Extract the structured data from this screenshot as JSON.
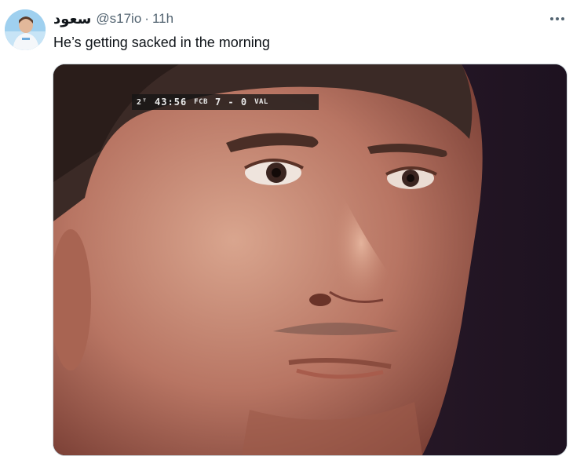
{
  "tweet": {
    "display_name": "سعود",
    "handle": "@s17io",
    "separator": "·",
    "time": "11h",
    "text": "He’s getting sacked in the morning",
    "more_icon": "more-horizontal-icon"
  },
  "media": {
    "scorebug": {
      "half": "2ᵀ",
      "clock": "43:56",
      "home_team": "FCB",
      "score": "7 - 0",
      "away_team": "VAL"
    }
  },
  "colors": {
    "text_primary": "#0f1419",
    "text_secondary": "#536471",
    "media_border": "#cfd9de"
  }
}
